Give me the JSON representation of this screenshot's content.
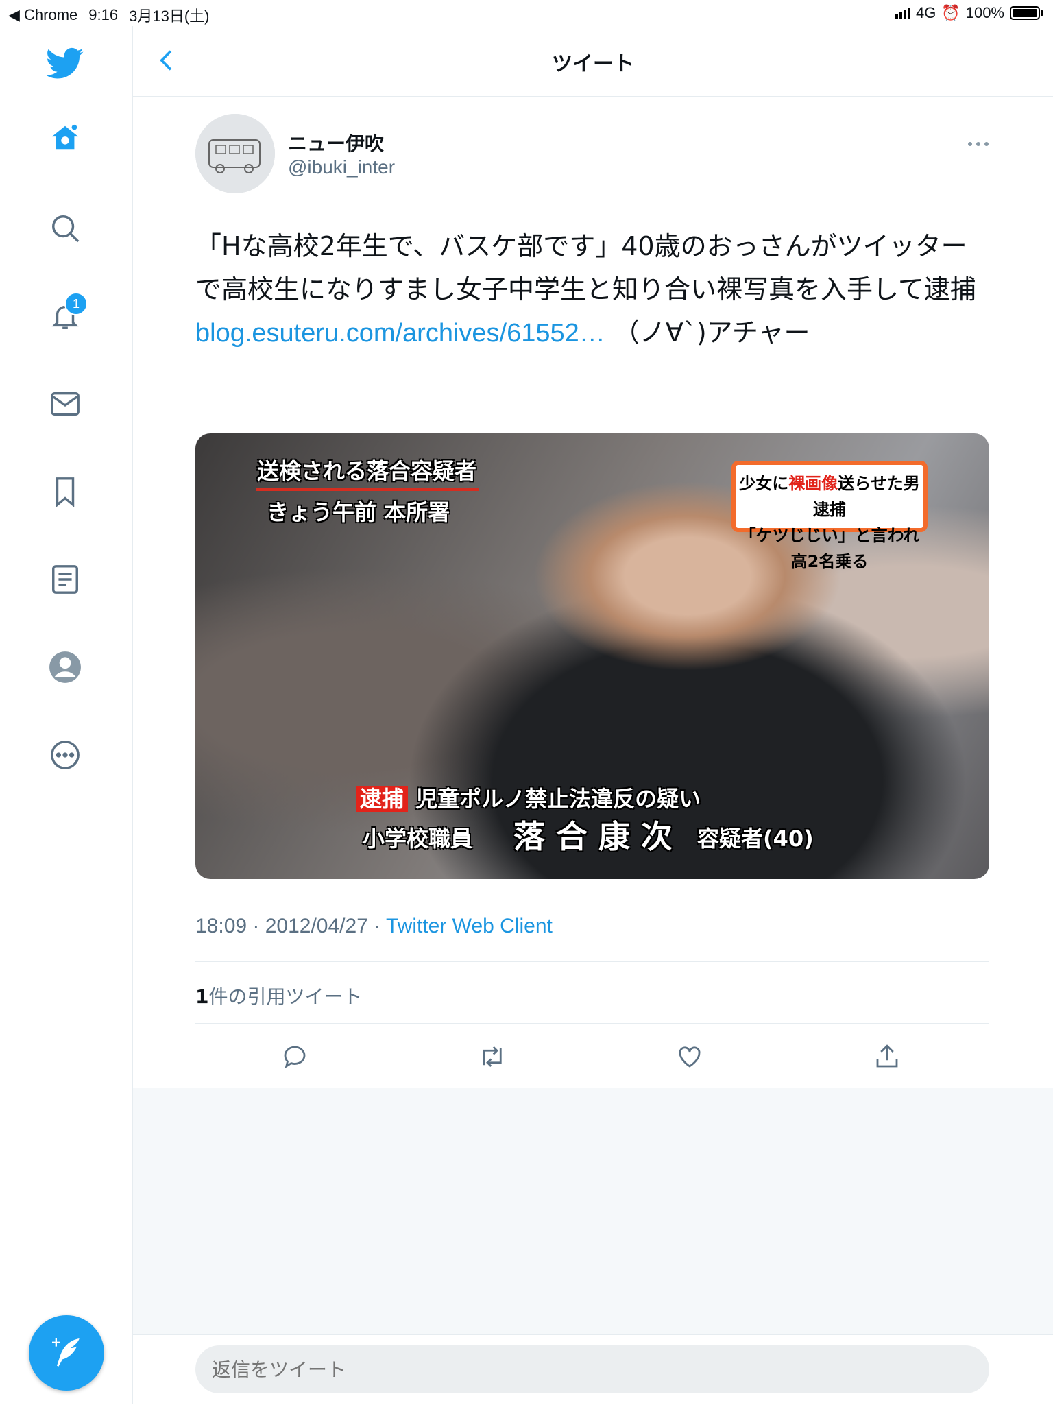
{
  "status_bar": {
    "back_app": "◀ Chrome",
    "time": "9:16",
    "date": "3月13日(土)",
    "network": "4G",
    "battery": "100%"
  },
  "header": {
    "title": "ツイート"
  },
  "sidebar": {
    "notification_badge": "1",
    "items": [
      "home-icon",
      "search-icon",
      "notifications-icon",
      "messages-icon",
      "bookmarks-icon",
      "lists-icon",
      "profile-icon",
      "more-icon"
    ]
  },
  "tweet": {
    "author_name": "ニュー伊吹",
    "author_handle": "@ibuki_inter",
    "text_before_link": "「Hな高校2年生で、バスケ部です」40歳のおっさんがツイッターで高校生になりすまし女子中学生と知り合い裸写真を入手して逮捕 ",
    "link": "blog.esuteru.com/archives/61552…",
    "text_after_link": " （ノ∀`)アチャー",
    "timestamp": "18:09 · 2012/04/27 · ",
    "client": "Twitter Web Client",
    "quote_count": "1",
    "quote_label": "件の引用ツイート"
  },
  "media": {
    "caption_top_left_1": "送検される落合容疑者",
    "caption_top_left_2": "きょう午前 本所署",
    "box_line1_a": "少女に",
    "box_line1_hl": "裸画像",
    "box_line1_b": "送らせた男逮捕",
    "box_line2": "「ケツじじい」と言われ高2名乗る",
    "arrest_tag": "逮捕",
    "charge": "児童ポルノ禁止法違反の疑い",
    "occupation": "小学校職員",
    "suspect_name": "落 合 康 次",
    "suspect_suffix": "容疑者(40)"
  },
  "reply": {
    "placeholder": "返信をツイート"
  },
  "colors": {
    "accent": "#1da1f2",
    "link": "#1b95e0",
    "muted": "#5b7083"
  }
}
